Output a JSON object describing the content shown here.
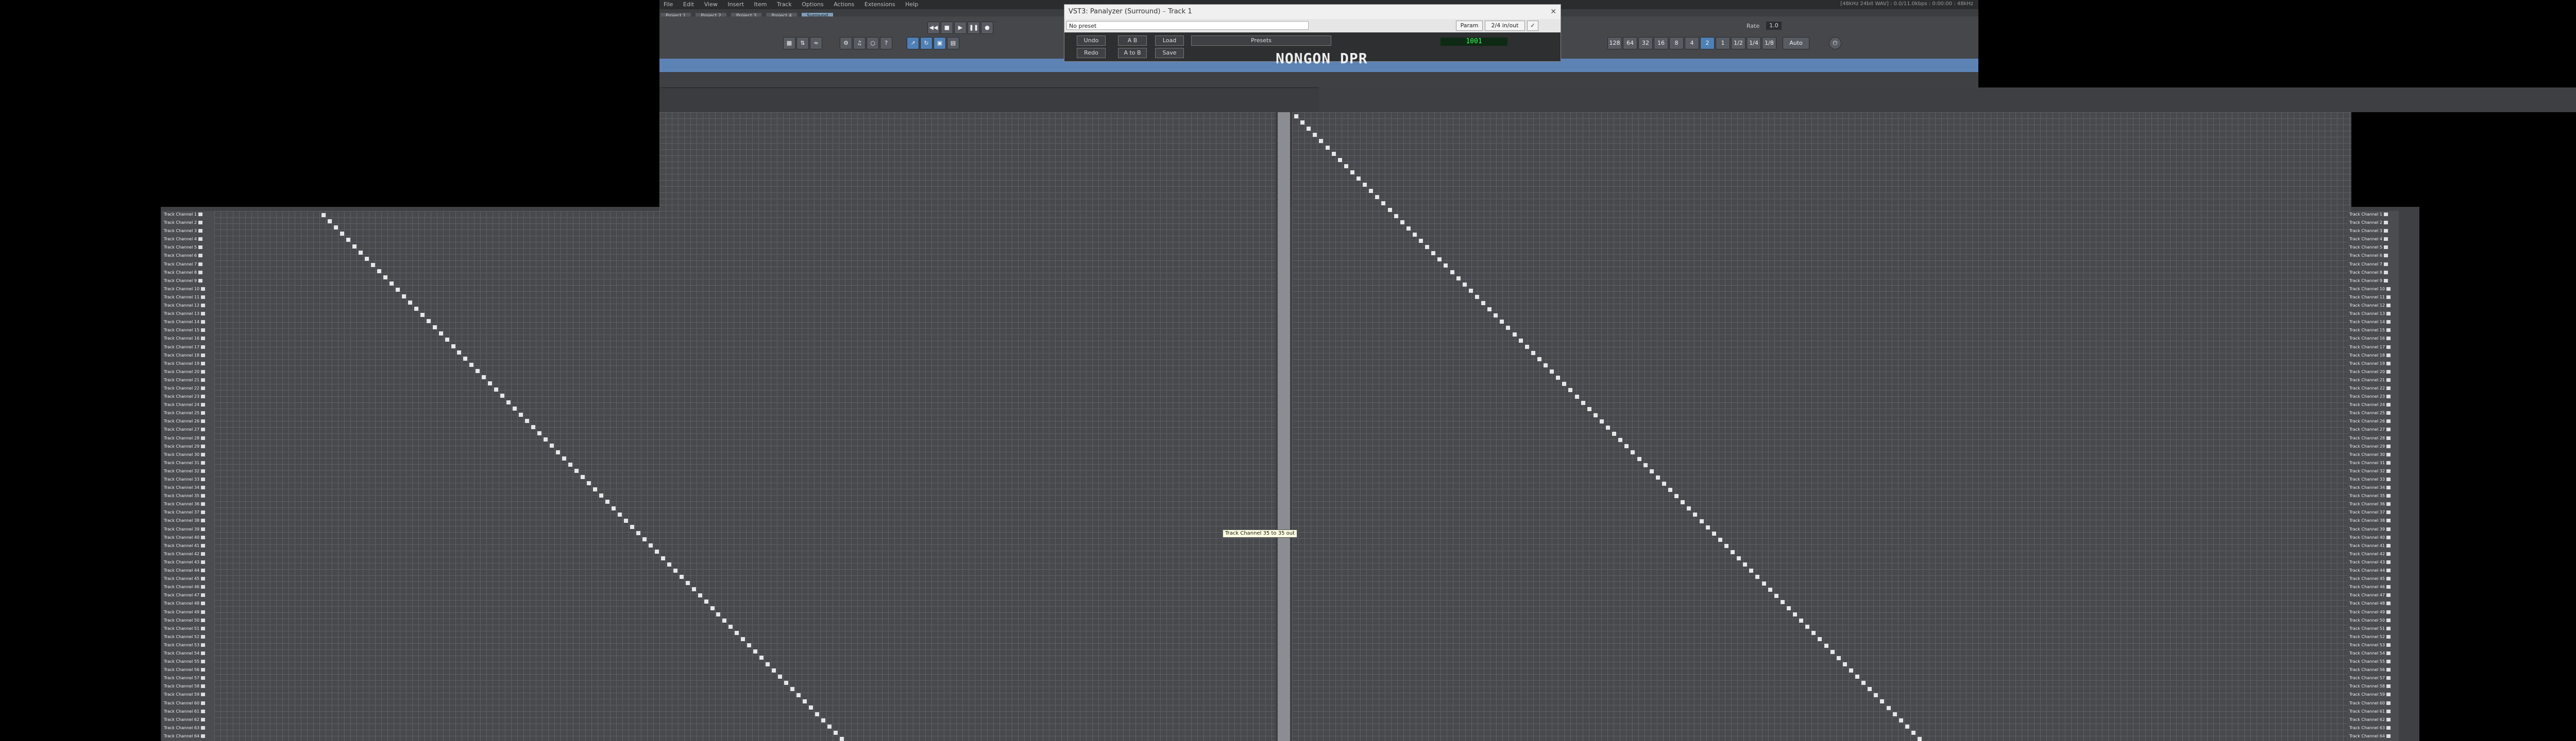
{
  "menu": {
    "items": [
      "File",
      "Edit",
      "View",
      "Insert",
      "Item",
      "Track",
      "Options",
      "Actions",
      "Extensions",
      "Help"
    ],
    "status": "[48kHz 24bit WAV] : 0.0/11.0kbps : 0:00:00 : 48kHz"
  },
  "tabs": [
    "Project 1",
    "Project 2",
    "Project 3",
    "Project 4",
    "Surround"
  ],
  "fx_window": {
    "title": "VST3: Panalyzer (Surround)",
    "track": "Track 1",
    "preset": "No preset",
    "param_label": "Param",
    "io_label": "2/4 in/out",
    "undo": "Undo",
    "redo": "Redo",
    "load": "Load",
    "save": "Save",
    "ab": "A  B",
    "atob": "A to B",
    "presets_label": "Presets",
    "brand": "NONGON DPR",
    "counter": "1001"
  },
  "tooltip": "Track Channel 35 to 35 out",
  "left_labels": [
    "Track Channel 1",
    "Track Channel 2",
    "Track Channel 3",
    "Track Channel 4",
    "Track Channel 5",
    "Track Channel 6",
    "Track Channel 7",
    "Track Channel 8",
    "Track Channel 9",
    "Track Channel 10",
    "Track Channel 11",
    "Track Channel 12",
    "Track Channel 13",
    "Track Channel 14",
    "Track Channel 15",
    "Track Channel 16",
    "Track Channel 17",
    "Track Channel 18",
    "Track Channel 19",
    "Track Channel 20",
    "Track Channel 21",
    "Track Channel 22",
    "Track Channel 23",
    "Track Channel 24",
    "Track Channel 25",
    "Track Channel 26",
    "Track Channel 27",
    "Track Channel 28",
    "Track Channel 29",
    "Track Channel 30",
    "Track Channel 31",
    "Track Channel 32",
    "Track Channel 33",
    "Track Channel 34",
    "Track Channel 35",
    "Track Channel 36",
    "Track Channel 37",
    "Track Channel 38",
    "Track Channel 39",
    "Track Channel 40",
    "Track Channel 41",
    "Track Channel 42",
    "Track Channel 43",
    "Track Channel 44",
    "Track Channel 45",
    "Track Channel 46",
    "Track Channel 47",
    "Track Channel 48",
    "Track Channel 49",
    "Track Channel 50",
    "Track Channel 51",
    "Track Channel 52",
    "Track Channel 53",
    "Track Channel 54",
    "Track Channel 55",
    "Track Channel 56",
    "Track Channel 57",
    "Track Channel 58",
    "Track Channel 59",
    "Track Channel 60",
    "Track Channel 61",
    "Track Channel 62",
    "Track Channel 63",
    "Track Channel 64"
  ],
  "right_labels": [
    "Track Channel 1",
    "Track Channel 2",
    "Track Channel 3",
    "Track Channel 4",
    "Track Channel 5",
    "Track Channel 6",
    "Track Channel 7",
    "Track Channel 8",
    "Track Channel 9",
    "Track Channel 10",
    "Track Channel 11",
    "Track Channel 12",
    "Track Channel 13",
    "Track Channel 14",
    "Track Channel 15",
    "Track Channel 16",
    "Track Channel 17",
    "Track Channel 18",
    "Track Channel 19",
    "Track Channel 20",
    "Track Channel 21",
    "Track Channel 22",
    "Track Channel 23",
    "Track Channel 24",
    "Track Channel 25",
    "Track Channel 26",
    "Track Channel 27",
    "Track Channel 28",
    "Track Channel 29",
    "Track Channel 30",
    "Track Channel 31",
    "Track Channel 32",
    "Track Channel 33",
    "Track Channel 34",
    "Track Channel 35",
    "Track Channel 36",
    "Track Channel 37",
    "Track Channel 38",
    "Track Channel 39",
    "Track Channel 40",
    "Track Channel 41",
    "Track Channel 42",
    "Track Channel 43",
    "Track Channel 44",
    "Track Channel 45",
    "Track Channel 46",
    "Track Channel 47",
    "Track Channel 48",
    "Track Channel 49",
    "Track Channel 50",
    "Track Channel 51",
    "Track Channel 52",
    "Track Channel 53",
    "Track Channel 54",
    "Track Channel 55",
    "Track Channel 56",
    "Track Channel 57",
    "Track Channel 58",
    "Track Channel 59",
    "Track Channel 60",
    "Track Channel 61",
    "Track Channel 62",
    "Track Channel 63",
    "Track Channel 64"
  ],
  "toolbar": {
    "icons": [
      "rewind-icon",
      "stop-icon",
      "play-icon",
      "pause-icon",
      "record-icon",
      "loop-icon",
      "metronome-icon",
      "grid-icon",
      "snap-icon",
      "ripple-icon",
      "envelope-icon",
      "lock-icon",
      "help-icon"
    ],
    "rate_label": "Rate",
    "rate_value": "1.0",
    "zoom_buttons": [
      "128",
      "64",
      "32",
      "16",
      "8",
      "4",
      "2",
      "1",
      "1/2",
      "1/4",
      "1/8"
    ],
    "auto_label": "Auto"
  },
  "colors": {
    "accent": "#5d83b5",
    "grid_bg": "#47494d",
    "grid_line": "#5c5f63",
    "active_cell": "#e6e6e6"
  }
}
